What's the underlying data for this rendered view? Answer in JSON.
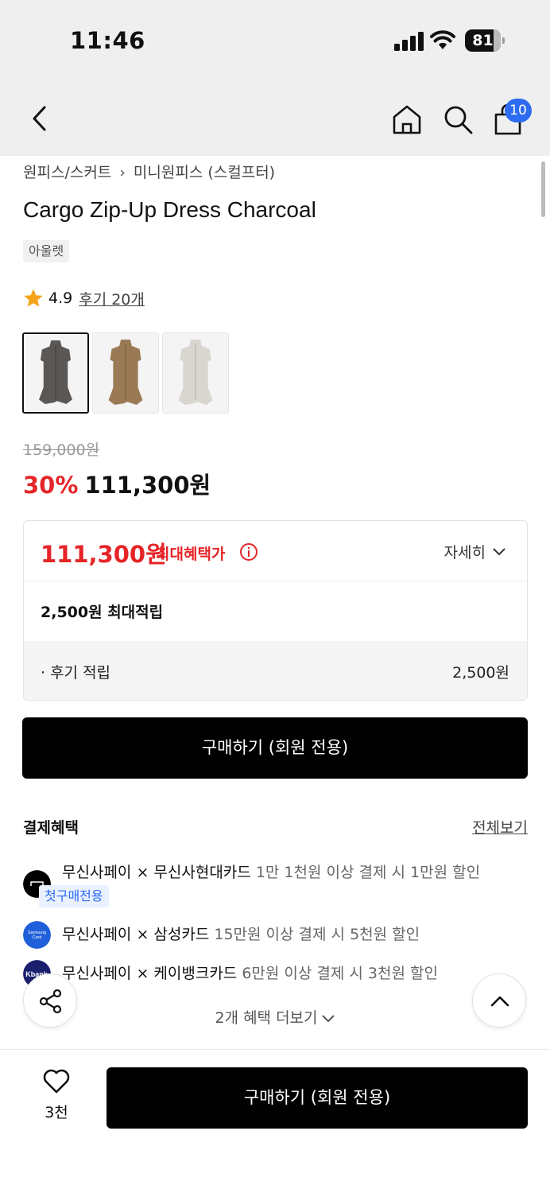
{
  "status_bar": {
    "time": "11:46",
    "battery": "81"
  },
  "header": {
    "cart_count": "10"
  },
  "breadcrumb": {
    "level1": "원피스/스커트",
    "level2": "미니원피스 (스컬프터)"
  },
  "product": {
    "name": "Cargo Zip-Up Dress Charcoal",
    "tag": "아울렛",
    "rating": "4.9",
    "reviews_link": "후기 20개",
    "color_options": [
      {
        "color": "#5a5754",
        "selected": true
      },
      {
        "color": "#9a7a55",
        "selected": false
      },
      {
        "color": "#d9d5cf",
        "selected": false
      }
    ],
    "original_price": "159,000원",
    "discount": "30%",
    "sale_price": "111,300원"
  },
  "benefit": {
    "max_price": "111,300원",
    "max_price_label": "최대혜택가",
    "detail_label": "자세히",
    "points_total": "2,500원 최대적립",
    "review_points_label": "· 후기 적립",
    "review_points_value": "2,500원"
  },
  "buy_button": "구매하기 (회원 전용)",
  "payment": {
    "title": "결제혜택",
    "view_all": "전체보기",
    "items": [
      {
        "name": "무신사페이 × 무신사현대카드",
        "desc": "1만 1천원 이상 결제 시 1만원 할인",
        "chip": "첫구매전용",
        "logo_color": "#000000"
      },
      {
        "name": "무신사페이 × 삼성카드",
        "desc": "15만원 이상 결제 시 5천원 할인",
        "logo_text": "Samsung Card",
        "logo_color": "#1f5fd9"
      },
      {
        "name": "무신사페이 × 케이뱅크카드",
        "desc": "6만원 이상 결제 시 3천원 할인",
        "logo_text": "Kbank",
        "logo_color": "#1a1f6e"
      }
    ],
    "more": "2개 혜택 더보기"
  },
  "bottom_bar": {
    "likes": "3천",
    "buy_label": "구매하기 (회원 전용)"
  }
}
